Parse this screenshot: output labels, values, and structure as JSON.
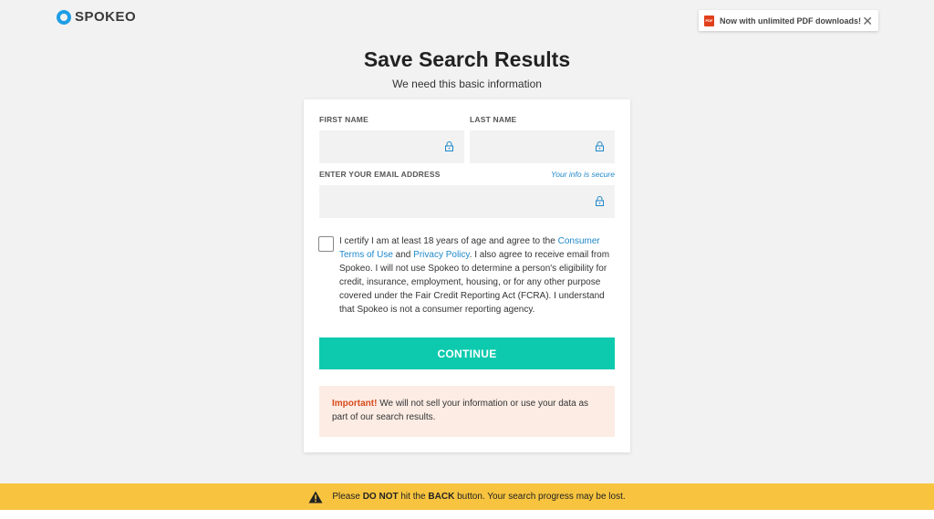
{
  "brand": {
    "name": "SPOKEO",
    "color": "#1e9ee6"
  },
  "toast": {
    "icon": "pdf-icon",
    "icon_text": "PDF",
    "text": "Now with unlimited PDF downloads!",
    "close": "✕"
  },
  "header": {
    "title": "Save Search Results",
    "subtitle": "We need this basic information"
  },
  "form": {
    "first_name": {
      "label": "FIRST NAME",
      "value": "",
      "placeholder": ""
    },
    "last_name": {
      "label": "LAST NAME",
      "value": "",
      "placeholder": ""
    },
    "email": {
      "label": "ENTER YOUR EMAIL ADDRESS",
      "secure_note": "Your info is secure",
      "value": "",
      "placeholder": ""
    },
    "certify": {
      "checked": false,
      "text_1": "I certify I am at least 18 years of age and agree to the ",
      "link_terms": "Consumer Terms of Use",
      "text_2": " and ",
      "link_privacy": "Privacy Policy",
      "text_3": ". I also agree to receive email from Spokeo. I will not use Spokeo to determine a person's eligibility for credit, insurance, employment, housing, or for any other purpose covered under the Fair Credit Reporting Act (FCRA). I understand that Spokeo is not a consumer reporting agency."
    },
    "continue_label": "CONTINUE",
    "important": {
      "label": "Important!",
      "text": " We will not sell your information or use your data as part of our search results."
    }
  },
  "banner": {
    "icon": "warning-icon",
    "part_1": "Please ",
    "bold_1": "DO NOT",
    "part_2": " hit the ",
    "bold_2": "BACK",
    "part_3": " button. Your search progress may be lost."
  },
  "colors": {
    "accent": "#0dcaae",
    "link": "#1e88c9",
    "banner": "#f8c43f",
    "important": "#d84a1b"
  }
}
